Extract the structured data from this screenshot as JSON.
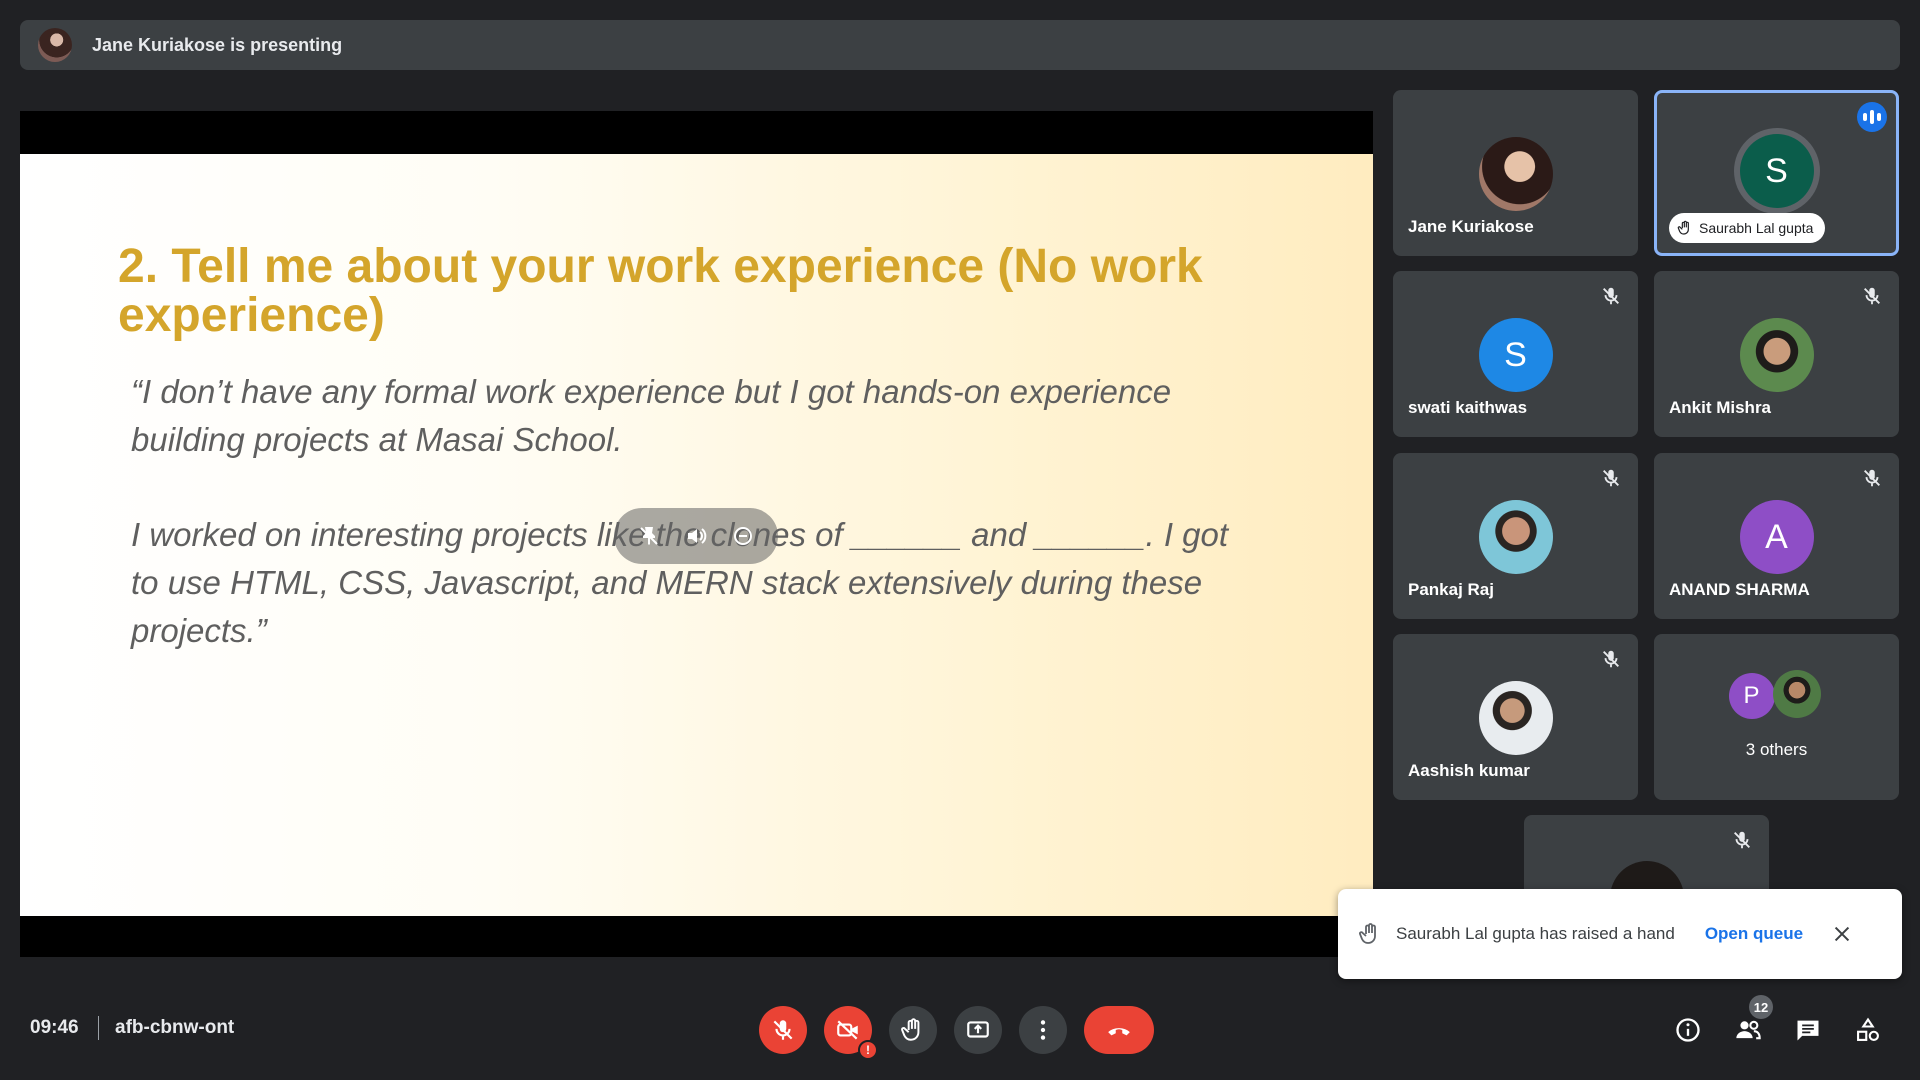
{
  "presenting_banner": {
    "text": "Jane Kuriakose is presenting"
  },
  "slide": {
    "title": "2. Tell me about your work experience (No work experience)",
    "quote_paragraph_1": "“I don’t have any formal work experience but I got hands-on experience building projects at Masai School.",
    "quote_paragraph_2": "I worked on interesting projects like the clones of ______ and ______.  I got to use HTML, CSS, Javascript, and MERN stack extensively during these projects.”"
  },
  "participants": [
    {
      "name": "Jane Kuriakose",
      "avatar": "photo",
      "muted": false
    },
    {
      "name": "Saurabh Lal gupta",
      "initial": "S",
      "avatar_color": "#0b5d4b",
      "speaking": true,
      "hand_raised": true
    },
    {
      "name": "swati kaithwas",
      "initial": "S",
      "avatar_color": "#1e88e5",
      "muted": true
    },
    {
      "name": "Ankit Mishra",
      "avatar": "photo",
      "muted": true
    },
    {
      "name": "Pankaj Raj",
      "avatar": "photo",
      "muted": true
    },
    {
      "name": "ANAND SHARMA",
      "initial": "A",
      "avatar_color": "#8e4ec6",
      "muted": true
    },
    {
      "name": "Aashish kumar",
      "avatar": "photo",
      "muted": true
    },
    {
      "name": "3 others",
      "initial": "P",
      "avatar_color": "#8e4ec6"
    }
  ],
  "toast": {
    "message": "Saurabh Lal gupta has raised a hand",
    "action": "Open queue"
  },
  "bottom_bar": {
    "time": "09:46",
    "meeting_code": "afb-cbnw-ont",
    "people_count": "12",
    "camera_warning": "!"
  },
  "colors": {
    "background": "#202124",
    "tile": "#3c4043",
    "accent_blue": "#1a73e8",
    "danger_red": "#ea4335",
    "slide_title": "#d4a52b"
  },
  "icons": [
    "mic-off-icon",
    "camera-off-icon",
    "raise-hand-icon",
    "present-icon",
    "more-options-icon",
    "end-call-icon",
    "info-icon",
    "people-icon",
    "chat-icon",
    "activities-icon",
    "close-icon",
    "speaking-icon"
  ]
}
